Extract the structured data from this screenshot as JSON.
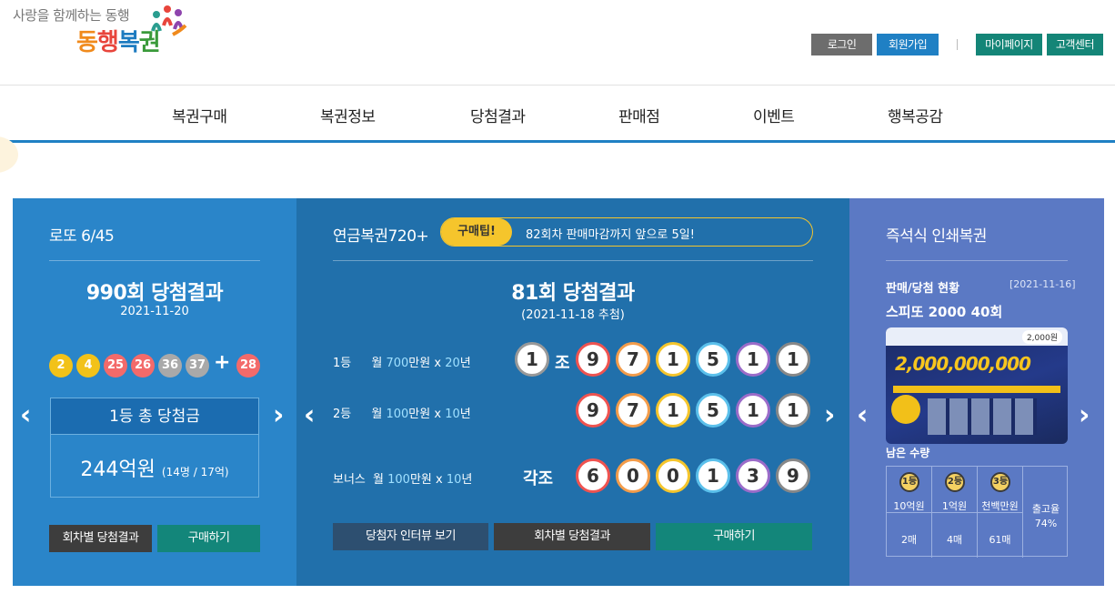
{
  "header": {
    "tagline": "사랑을 함께하는 동행",
    "logo": [
      "동",
      "행",
      "복",
      "권"
    ],
    "buttons": {
      "login": "로그인",
      "join": "회원가입",
      "mypage": "마이페이지",
      "support": "고객센터"
    }
  },
  "nav": [
    "복권구매",
    "복권정보",
    "당첨결과",
    "판매점",
    "이벤트",
    "행복공감"
  ],
  "lotto": {
    "title": "로또 6/45",
    "round_title": "990회 당첨결과",
    "date": "2021-11-20",
    "numbers": [
      "2",
      "4",
      "25",
      "26",
      "36",
      "37"
    ],
    "plus": "+",
    "bonus": "28",
    "prize_label": "1등 총 당첨금",
    "prize_amount": "244억원",
    "prize_detail": "(14명 / 17억)",
    "btn_results": "회차별 당첨결과",
    "btn_buy": "구매하기"
  },
  "pension": {
    "title": "연금복권720+",
    "tip_label": "구매팁!",
    "tip_text": "82회차 판매마감까지 앞으로 5일!",
    "round_title": "81회 당첨결과",
    "date": "(2021-11-18 추첨)",
    "rows": [
      {
        "rank": "1등",
        "pre": "월 ",
        "amount": "700",
        "post": "만원 x ",
        "years": "20",
        "suffix": "년"
      },
      {
        "rank": "2등",
        "pre": "월 ",
        "amount": "100",
        "post": "만원 x ",
        "years": "10",
        "suffix": "년"
      },
      {
        "rank": "보너스",
        "pre": "월 ",
        "amount": "100",
        "post": "만원 x ",
        "years": "10",
        "suffix": "년"
      }
    ],
    "group": "1",
    "jo": "조",
    "first_numbers": [
      "9",
      "7",
      "1",
      "5",
      "1",
      "1"
    ],
    "second_numbers": [
      "9",
      "7",
      "1",
      "5",
      "1",
      "1"
    ],
    "bonus_prefix": "각조",
    "bonus_numbers": [
      "6",
      "0",
      "0",
      "1",
      "3",
      "9"
    ],
    "btn_interview": "당첨자 인터뷰 보기",
    "btn_results": "회차별 당첨결과",
    "btn_buy": "구매하기"
  },
  "instant": {
    "title": "즉석식 인쇄복권",
    "status_label": "판매/당첨 현황",
    "status_date": "[2021-11-16]",
    "product": "스피또 2000 40회",
    "ticket_text": "2,000,000,000",
    "ticket_price": "2,000원",
    "remaining_label": "남은 수량",
    "prizes": [
      {
        "rank": "1등",
        "name": "10억원",
        "count": "2매"
      },
      {
        "rank": "2등",
        "name": "1억원",
        "count": "4매"
      },
      {
        "rank": "3등",
        "name": "천백만원",
        "count": "61매"
      }
    ],
    "release_label": "출고율",
    "release_rate": "74%"
  },
  "colors": {
    "primary": "#1f80c4",
    "teal": "#148577",
    "lotto_bg": "#2a85c9",
    "pension_bg": "#2170ab",
    "instant_bg": "#5b79c4"
  }
}
